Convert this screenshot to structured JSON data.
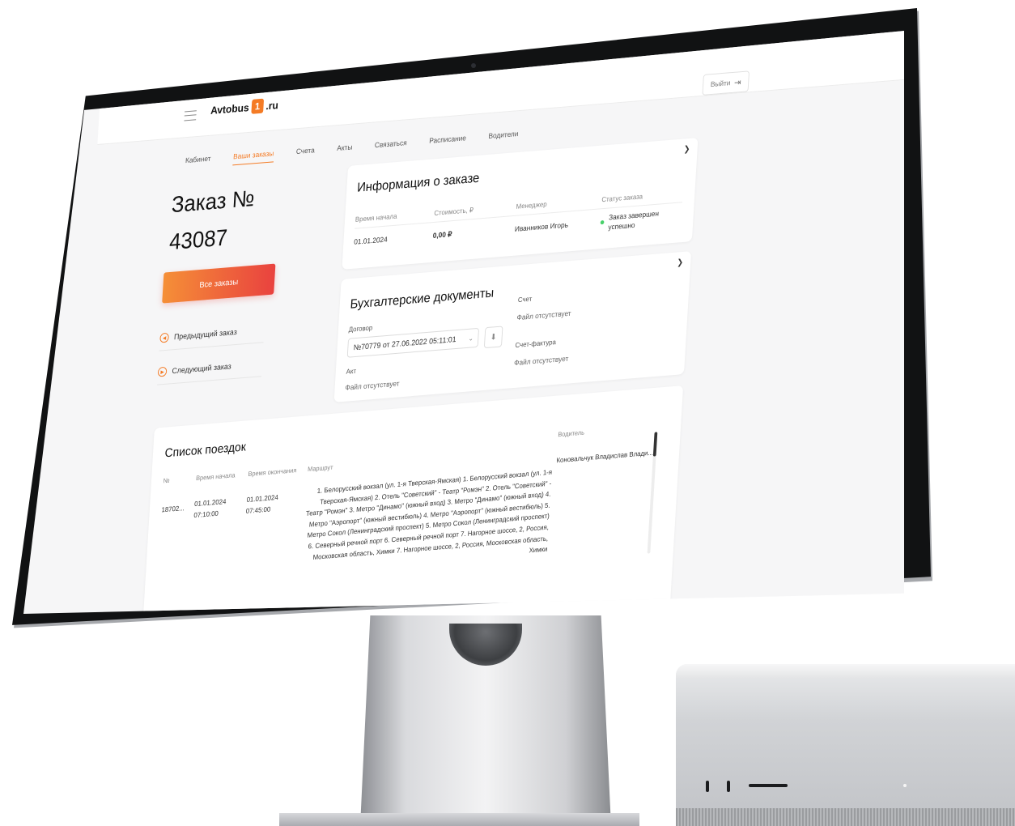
{
  "app": {
    "logo_text": "Avtobus",
    "logo_badge": "1",
    "logo_suffix": ".ru",
    "logout_label": "Выйти",
    "logout_icon": "logout-arrow-icon"
  },
  "nav": {
    "tabs": [
      {
        "label": "Кабинет",
        "active": false
      },
      {
        "label": "Ваши заказы",
        "active": true
      },
      {
        "label": "Счета",
        "active": false
      },
      {
        "label": "Акты",
        "active": false
      },
      {
        "label": "Связаться",
        "active": false
      },
      {
        "label": "Расписание",
        "active": false
      },
      {
        "label": "Водители",
        "active": false
      }
    ]
  },
  "order": {
    "title_line1": "Заказ №",
    "title_line2": "43087",
    "all_orders_label": "Все заказы",
    "prev_label": "Предыдущий заказ",
    "next_label": "Следующий заказ"
  },
  "info": {
    "title": "Информация о заказе",
    "start_label": "Время начала",
    "start_value": "01.01.2024",
    "cost_label": "Стоимость, ₽",
    "cost_value": "0,00 ₽",
    "manager_label": "Менеджер",
    "manager_value": "Иванников Игорь",
    "status_label": "Статус заказа",
    "status_value": "Заказ завершен успешно",
    "status_color": "#49d16b"
  },
  "docs": {
    "title": "Бухгалтерские документы",
    "contract_label": "Договор",
    "contract_value": "№70779 от 27.06.2022 05:11:01",
    "invoice_label": "Счет",
    "invoice_value": "Файл отсутствует",
    "invoice_fact_label": "Счет-фактура",
    "invoice_fact_value": "Файл отсутствует",
    "act_label": "Акт",
    "act_value": "Файл отсутствует"
  },
  "trips": {
    "title": "Список поездок",
    "headers": {
      "num": "№",
      "start": "Время начала",
      "end": "Время окончания",
      "route": "Маршрут",
      "driver": "Водитель"
    },
    "rows": [
      {
        "num": "18702...",
        "start_date": "01.01.2024",
        "start_time": "07:10:00",
        "end_date": "01.01.2024",
        "end_time": "07:45:00",
        "route": "1. Белорусский вокзал (ул. 1-я Тверская-Ямская) 1. Белорусский вокзал (ул. 1-я Тверская-Ямская) 2. Отель \"Советский\" - Театр \"Ромэн\" 2. Отель \"Советский\" - Театр \"Ромэн\" 3. Метро \"Динамо\" (южный вход) 3. Метро \"Динамо\" (южный вход) 4. Метро \"Аэропорт\" (южный вестибюль) 4. Метро \"Аэропорт\" (южный вестибюль) 5. Метро Сокол (Ленинградский проспект) 5. Метро Сокол (Ленинградский проспект) 6. Северный речной порт 6. Северный речной порт 7. Нагорное шоссе, 2, Россия, Московская область, Химки 7. Нагорное шоссе, 2, Россия, Московская область, Химки",
        "driver": "Коновальчук Владислав Влади..."
      }
    ]
  }
}
